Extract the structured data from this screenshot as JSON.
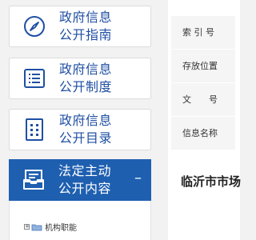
{
  "sidebar": {
    "items": [
      {
        "line1": "政府信息",
        "line2": "公开指南",
        "icon": "compass-icon"
      },
      {
        "line1": "政府信息",
        "line2": "公开制度",
        "icon": "list-document-icon"
      },
      {
        "line1": "政府信息",
        "line2": "公开目录",
        "icon": "grid-catalog-icon"
      }
    ],
    "active": {
      "line1": "法定主动",
      "line2": "公开内容",
      "icon": "mail-tray-icon",
      "toggle": "–"
    },
    "tree": {
      "expander": "+",
      "label": "机构职能",
      "icon": "folder-icon"
    }
  },
  "main": {
    "table": [
      {
        "key": "索 引 号"
      },
      {
        "key": "存放位置"
      },
      {
        "key": "文　　号"
      },
      {
        "key": "信息名称"
      }
    ],
    "title": "临沂市市场"
  },
  "colors": {
    "accent": "#1e5fb0",
    "link_text": "#1f4fa3"
  }
}
